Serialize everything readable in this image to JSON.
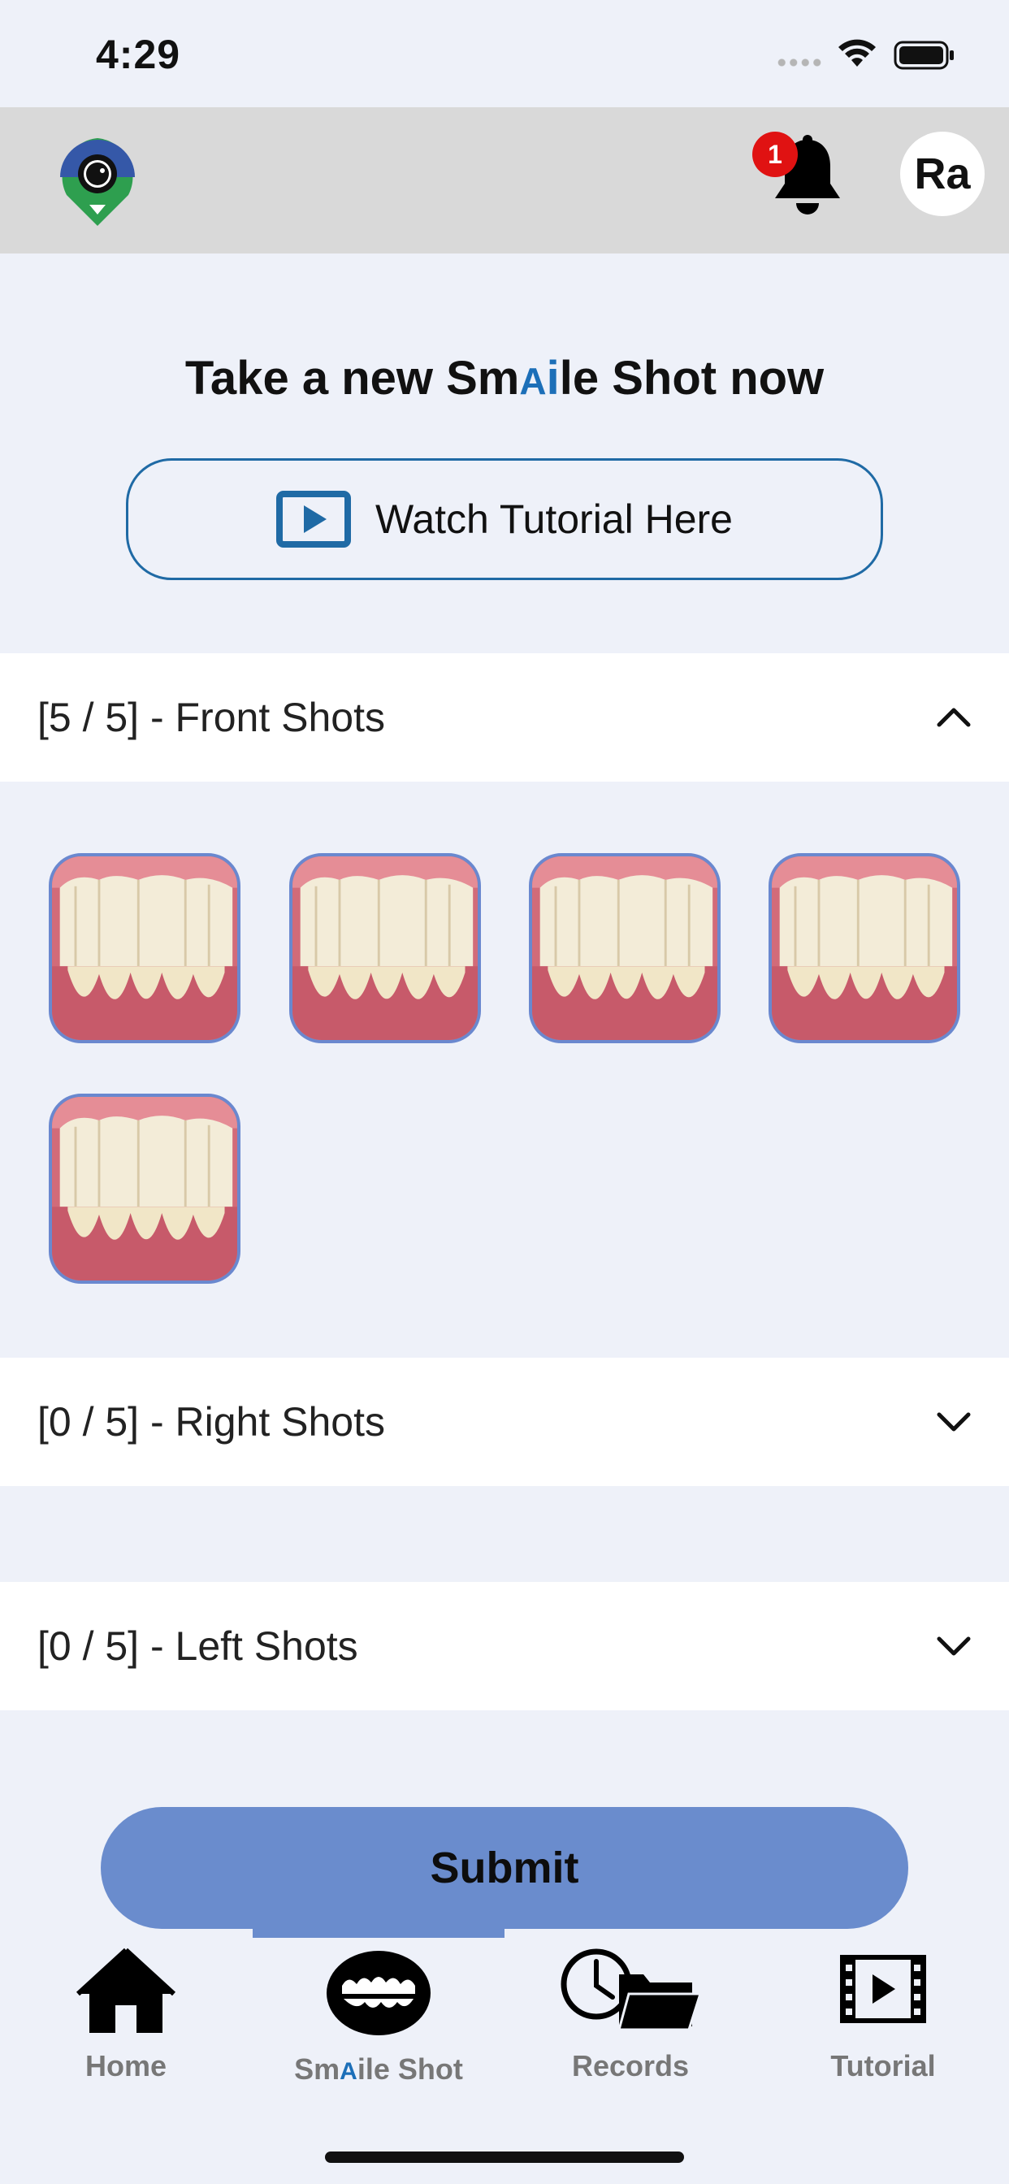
{
  "status_bar": {
    "time": "4:29"
  },
  "header": {
    "badge_count": "1",
    "avatar_initials": "Ra"
  },
  "hero": {
    "title_prefix": "Take a new Sm",
    "title_ai": "A",
    "title_i": "i",
    "title_suffix": "le Shot now",
    "tutorial_button": "Watch Tutorial Here"
  },
  "sections": [
    {
      "title": "[5  / 5] - Front Shots",
      "expanded": true,
      "count": 5
    },
    {
      "title": "[0  / 5] - Right Shots",
      "expanded": false,
      "count": 0
    },
    {
      "title": "[0  / 5] - Left Shots",
      "expanded": false,
      "count": 0
    }
  ],
  "submit": {
    "label": "Submit"
  },
  "tabs": [
    {
      "label": "Home",
      "icon": "house-icon"
    },
    {
      "label_prefix": "Sm",
      "label_ai": "A",
      "label_suffix": "ile Shot",
      "icon": "teeth-icon",
      "active": true
    },
    {
      "label": "Records",
      "icon": "clock-folder-icon"
    },
    {
      "label": "Tutorial",
      "icon": "film-play-icon"
    }
  ],
  "colors": {
    "accent": "#6a8ccd",
    "brand_blue": "#1c6fb8",
    "badge": "#e01212"
  }
}
